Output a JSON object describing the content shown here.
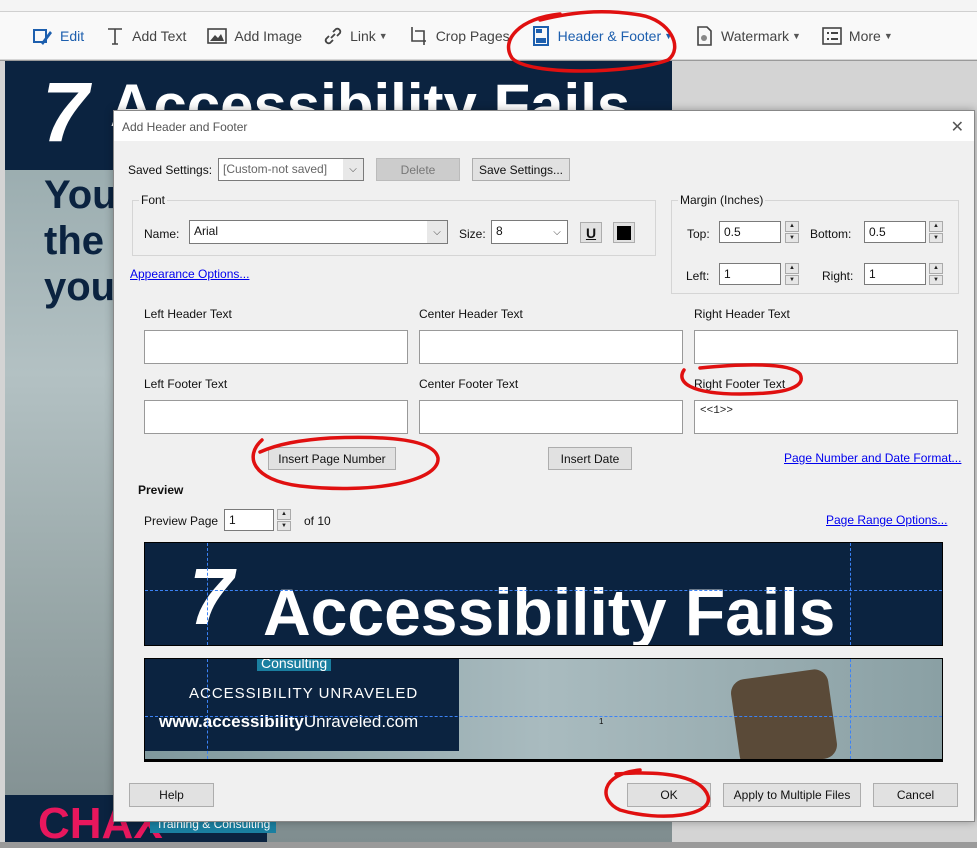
{
  "toolbar": {
    "items": [
      {
        "label": "Edit",
        "icon": "edit-icon"
      },
      {
        "label": "Add Text",
        "icon": "text-icon"
      },
      {
        "label": "Add Image",
        "icon": "image-icon"
      },
      {
        "label": "Link",
        "icon": "link-icon",
        "dropdown": true
      },
      {
        "label": "Crop Pages",
        "icon": "crop-icon"
      },
      {
        "label": "Header & Footer",
        "icon": "header-footer-icon",
        "dropdown": true,
        "active": true
      },
      {
        "label": "Watermark",
        "icon": "watermark-icon",
        "dropdown": true
      },
      {
        "label": "More",
        "icon": "more-icon",
        "dropdown": true
      }
    ]
  },
  "document": {
    "title_number": "7",
    "title": "Accessibility Fails",
    "subtitle_lines": [
      "You",
      "the",
      "you"
    ],
    "brand": "CHAX",
    "brand_tag": "Training & Consulting"
  },
  "dialog": {
    "title": "Add Header and Footer",
    "saved_settings_label": "Saved Settings:",
    "saved_settings_value": "[Custom-not saved]",
    "delete_label": "Delete",
    "save_settings_label": "Save Settings...",
    "font_group": "Font",
    "name_label": "Name:",
    "font_name": "Arial",
    "size_label": "Size:",
    "font_size": "8",
    "underline_label": "U",
    "appearance_options": "Appearance Options...",
    "margin_group": "Margin (Inches)",
    "margins": {
      "top_label": "Top:",
      "top": "0.5",
      "bottom_label": "Bottom:",
      "bottom": "0.5",
      "left_label": "Left:",
      "left": "1",
      "right_label": "Right:",
      "right": "1"
    },
    "fields": {
      "left_header": {
        "label": "Left Header Text",
        "value": ""
      },
      "center_header": {
        "label": "Center Header Text",
        "value": ""
      },
      "right_header": {
        "label": "Right Header Text",
        "value": ""
      },
      "left_footer": {
        "label": "Left Footer Text",
        "value": ""
      },
      "center_footer": {
        "label": "Center Footer Text",
        "value": ""
      },
      "right_footer": {
        "label": "Right Footer Text",
        "value": "<<1>>"
      }
    },
    "insert_page_number": "Insert Page Number",
    "insert_date": "Insert Date",
    "page_number_format": "Page Number and Date Format...",
    "preview_label": "Preview",
    "preview_page_label": "Preview Page",
    "preview_page": "1",
    "preview_of": "of 10",
    "page_range_options": "Page Range Options...",
    "preview": {
      "title_number": "7",
      "title": "Accessibility Fails",
      "brand_partial": "Consulting",
      "tagline": "ACCESSIBILITY UNRAVELED",
      "url_bold": "www.accessibility",
      "url_rest": "Unraveled.com",
      "footer_page_number": "1"
    },
    "help": "Help",
    "ok": "OK",
    "apply_multiple": "Apply to Multiple Files",
    "cancel": "Cancel"
  },
  "colors": {
    "accent": "#1d5fae",
    "navy": "#0b2340",
    "annotation": "#e01010",
    "link": "#0000ee"
  }
}
